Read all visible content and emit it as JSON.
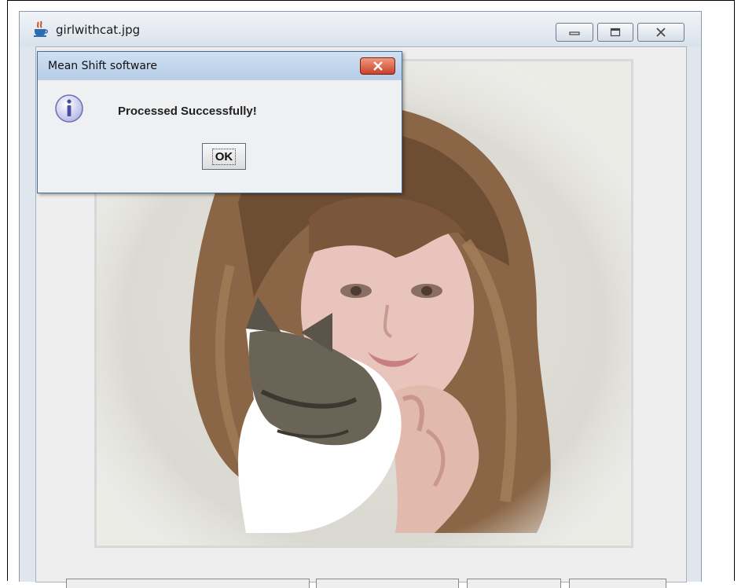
{
  "main_window": {
    "title": "girlwithcat.jpg",
    "controls": {
      "minimize_icon": "minimize-icon",
      "maximize_icon": "maximize-icon",
      "close_icon": "close-icon"
    }
  },
  "image": {
    "description_icon": "photo"
  },
  "dialog": {
    "title": "Mean Shift software",
    "message": "Processed  Successfully!",
    "ok_label": "OK",
    "icon": "info-icon"
  },
  "colors": {
    "window_frame": "#dfe6ee",
    "dialog_title_bg": "#bcd2ea",
    "close_red": "#c8412a"
  }
}
